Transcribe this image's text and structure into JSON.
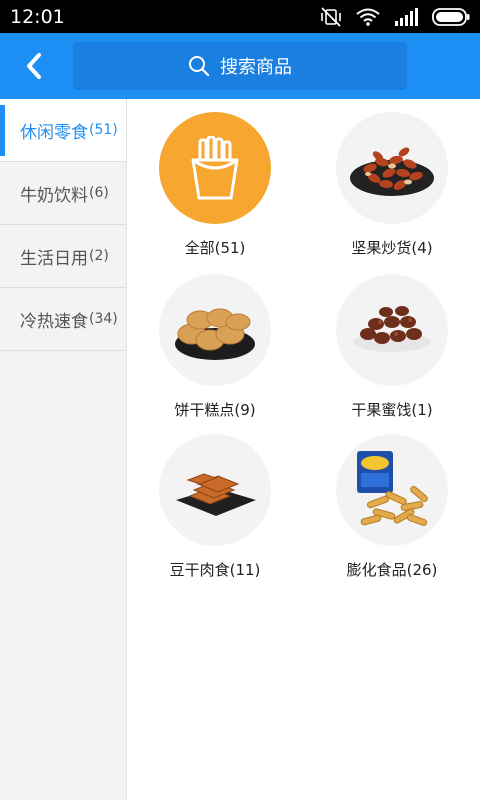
{
  "status_bar": {
    "time": "12:01",
    "icons": [
      "mute-vibrate-icon",
      "wifi-icon",
      "signal-icon",
      "battery-icon"
    ]
  },
  "header": {
    "back_icon": "chevron-left-icon",
    "search_placeholder": "搜索商品",
    "colors": {
      "bar": "#1e90f5",
      "search_box": "#1a7fe0"
    }
  },
  "sidebar": {
    "items": [
      {
        "label": "休闲零食",
        "count": "(51)",
        "active": true
      },
      {
        "label": "牛奶饮料",
        "count": "(6)",
        "active": false
      },
      {
        "label": "生活日用",
        "count": "(2)",
        "active": false
      },
      {
        "label": "冷热速食",
        "count": "(34)",
        "active": false
      }
    ]
  },
  "grid": {
    "items": [
      {
        "label": "全部(51)",
        "icon": "fries-icon"
      },
      {
        "label": "坚果炒货(4)",
        "icon": "nuts-image"
      },
      {
        "label": "饼干糕点(9)",
        "icon": "biscuits-image"
      },
      {
        "label": "干果蜜饯(1)",
        "icon": "dried-fruit-image"
      },
      {
        "label": "豆干肉食(11)",
        "icon": "tofu-snack-image"
      },
      {
        "label": "膨化食品(26)",
        "icon": "puffed-snack-image"
      }
    ]
  }
}
